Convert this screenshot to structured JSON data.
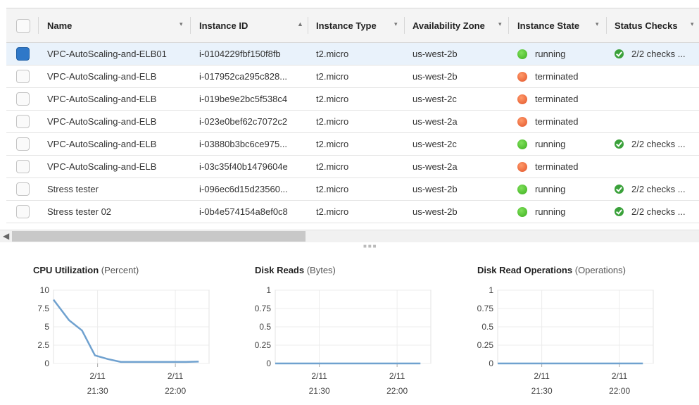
{
  "table": {
    "columns": [
      {
        "label": "Name",
        "sort": "▾"
      },
      {
        "label": "Instance ID",
        "sort": "▲"
      },
      {
        "label": "Instance Type",
        "sort": "▾"
      },
      {
        "label": "Availability Zone",
        "sort": "▾"
      },
      {
        "label": "Instance State",
        "sort": "▾"
      },
      {
        "label": "Status Checks",
        "sort": "▾"
      }
    ],
    "rows": [
      {
        "name": "VPC-AutoScaling-and-ELB01",
        "id": "i-0104229fbf150f8fb",
        "type": "t2.micro",
        "zone": "us-west-2b",
        "state": "running",
        "checks": "2/2 checks ...",
        "selected": true
      },
      {
        "name": "VPC-AutoScaling-and-ELB",
        "id": "i-017952ca295c828...",
        "type": "t2.micro",
        "zone": "us-west-2b",
        "state": "terminated",
        "checks": "",
        "selected": false
      },
      {
        "name": "VPC-AutoScaling-and-ELB",
        "id": "i-019be9e2bc5f538c4",
        "type": "t2.micro",
        "zone": "us-west-2c",
        "state": "terminated",
        "checks": "",
        "selected": false
      },
      {
        "name": "VPC-AutoScaling-and-ELB",
        "id": "i-023e0bef62c7072c2",
        "type": "t2.micro",
        "zone": "us-west-2a",
        "state": "terminated",
        "checks": "",
        "selected": false
      },
      {
        "name": "VPC-AutoScaling-and-ELB",
        "id": "i-03880b3bc6ce975...",
        "type": "t2.micro",
        "zone": "us-west-2c",
        "state": "running",
        "checks": "2/2 checks ...",
        "selected": false
      },
      {
        "name": "VPC-AutoScaling-and-ELB",
        "id": "i-03c35f40b1479604e",
        "type": "t2.micro",
        "zone": "us-west-2a",
        "state": "terminated",
        "checks": "",
        "selected": false
      },
      {
        "name": "Stress tester",
        "id": "i-096ec6d15d23560...",
        "type": "t2.micro",
        "zone": "us-west-2b",
        "state": "running",
        "checks": "2/2 checks ...",
        "selected": false
      },
      {
        "name": "Stress tester  02",
        "id": "i-0b4e574154a8ef0c8",
        "type": "t2.micro",
        "zone": "us-west-2b",
        "state": "running",
        "checks": "2/2 checks ...",
        "selected": false
      }
    ]
  },
  "colors": {
    "line": "#6fa1cf",
    "running": "#3cae1f",
    "terminated": "#e2542a",
    "selected_row": "#e9f2fb",
    "check": "#3aa13a"
  },
  "chart_data": [
    {
      "type": "line",
      "title": "CPU Utilization",
      "unit": "(Percent)",
      "yticks": [
        "10",
        "7.5",
        "5",
        "2.5",
        "0"
      ],
      "ylim": [
        0,
        10
      ],
      "xticks": [
        {
          "date": "2/11",
          "time": "21:30"
        },
        {
          "date": "2/11",
          "time": "22:00"
        }
      ],
      "x": [
        "21:13",
        "21:19",
        "21:24",
        "21:29",
        "21:34",
        "21:39",
        "21:49",
        "21:59",
        "22:04",
        "22:09"
      ],
      "values": [
        8.7,
        5.9,
        4.5,
        1.1,
        0.6,
        0.2,
        0.2,
        0.2,
        0.2,
        0.25
      ]
    },
    {
      "type": "line",
      "title": "Disk Reads",
      "unit": "(Bytes)",
      "yticks": [
        "1",
        "0.75",
        "0.5",
        "0.25",
        "0"
      ],
      "ylim": [
        0,
        1
      ],
      "xticks": [
        {
          "date": "2/11",
          "time": "21:30"
        },
        {
          "date": "2/11",
          "time": "22:00"
        }
      ],
      "x": [
        "21:13",
        "22:09"
      ],
      "values": [
        0,
        0
      ]
    },
    {
      "type": "line",
      "title": "Disk Read Operations",
      "unit": "(Operations)",
      "yticks": [
        "1",
        "0.75",
        "0.5",
        "0.25",
        "0"
      ],
      "ylim": [
        0,
        1
      ],
      "xticks": [
        {
          "date": "2/11",
          "time": "21:30"
        },
        {
          "date": "2/11",
          "time": "22:00"
        }
      ],
      "x": [
        "21:13",
        "22:09"
      ],
      "values": [
        0,
        0
      ]
    }
  ]
}
